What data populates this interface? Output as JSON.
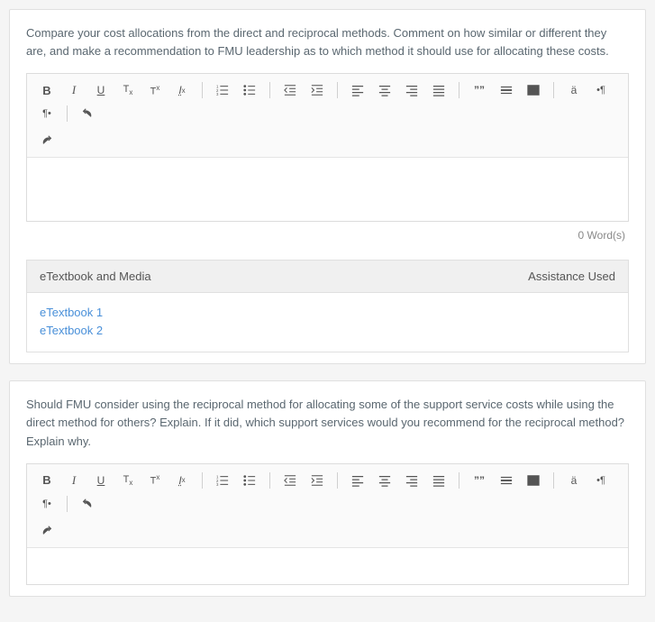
{
  "questions": [
    {
      "prompt": "Compare your cost allocations from the direct and reciprocal methods. Comment on how similar or different they are, and make a recommendation to FMU leadership as to which method it should use for allocating these costs.",
      "wordcount": "0 Word(s)"
    },
    {
      "prompt": "Should FMU consider using the reciprocal method for allocating some of the support service costs while using the direct method for others? Explain. If it did, which support services would you recommend for the reciprocal method? Explain why."
    }
  ],
  "accordion": {
    "title": "eTextbook and Media",
    "right": "Assistance Used",
    "links": [
      "eTextbook 1",
      "eTextbook 2"
    ]
  },
  "toolbar": {
    "bold": "B",
    "italic": "I",
    "underline": "U",
    "subscript": "T",
    "superscript": "T",
    "clearfmt": "I",
    "olist": "",
    "ulist": "",
    "outdent": "",
    "indent": "",
    "left": "",
    "center": "",
    "right": "",
    "justify": "",
    "quote": "””",
    "hr": "",
    "table": "",
    "special": "ä",
    "ltr": "•¶",
    "rtl": "¶•",
    "undo": "",
    "redo": ""
  }
}
